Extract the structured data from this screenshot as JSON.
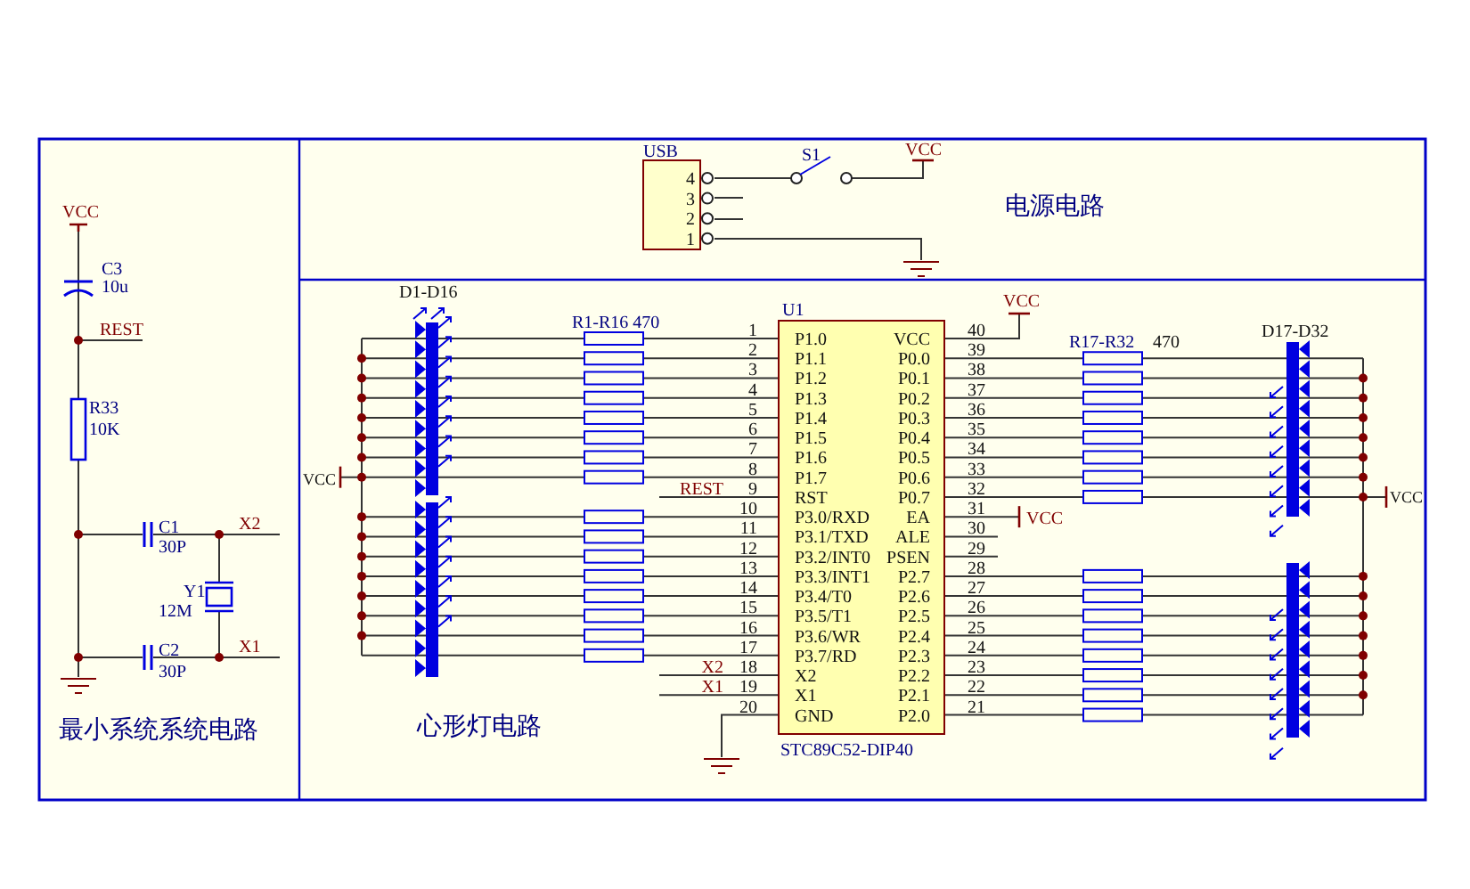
{
  "minimum_system": {
    "title": "最小系统系统电路",
    "vcc": "VCC",
    "c3": {
      "ref": "C3",
      "value": "10u"
    },
    "rest": "REST",
    "r33": {
      "ref": "R33",
      "value": "10K"
    },
    "c1": {
      "ref": "C1",
      "value": "30P"
    },
    "c2": {
      "ref": "C2",
      "value": "30P"
    },
    "y1": {
      "ref": "Y1",
      "value": "12M"
    },
    "x2": "X2",
    "x1": "X1"
  },
  "power": {
    "title": "电源电路",
    "usb": {
      "ref": "USB",
      "pins": [
        "4",
        "3",
        "2",
        "1"
      ]
    },
    "switch": "S1",
    "vcc": "VCC"
  },
  "heart_lights": {
    "title": "心形灯电路",
    "left_leds": "D1-D16",
    "left_resistors": "R1-R16 470",
    "left_vcc": "VCC",
    "right_resistors": "R17-R32",
    "right_resistor_value": "470",
    "right_leds": "D17-D32",
    "right_vcc": "VCC"
  },
  "chip": {
    "ref": "U1",
    "part": "STC89C52-DIP40",
    "vcc_pin40": "VCC",
    "vcc_pin31": "VCC",
    "left_pins": [
      {
        "number": "1",
        "name": "P1.0"
      },
      {
        "number": "2",
        "name": "P1.1"
      },
      {
        "number": "3",
        "name": "P1.2"
      },
      {
        "number": "4",
        "name": "P1.3"
      },
      {
        "number": "5",
        "name": "P1.4"
      },
      {
        "number": "6",
        "name": "P1.5"
      },
      {
        "number": "7",
        "name": "P1.6"
      },
      {
        "number": "8",
        "name": "P1.7"
      },
      {
        "number": "9",
        "name": "RST",
        "net": "REST"
      },
      {
        "number": "10",
        "name": "P3.0/RXD"
      },
      {
        "number": "11",
        "name": "P3.1/TXD"
      },
      {
        "number": "12",
        "name": "P3.2/INT0"
      },
      {
        "number": "13",
        "name": "P3.3/INT1"
      },
      {
        "number": "14",
        "name": "P3.4/T0"
      },
      {
        "number": "15",
        "name": "P3.5/T1"
      },
      {
        "number": "16",
        "name": "P3.6/WR"
      },
      {
        "number": "17",
        "name": "P3.7/RD"
      },
      {
        "number": "18",
        "name": "X2",
        "net": "X2"
      },
      {
        "number": "19",
        "name": "X1",
        "net": "X1"
      },
      {
        "number": "20",
        "name": "GND"
      }
    ],
    "right_pins": [
      {
        "number": "40",
        "name": "VCC"
      },
      {
        "number": "39",
        "name": "P0.0"
      },
      {
        "number": "38",
        "name": "P0.1"
      },
      {
        "number": "37",
        "name": "P0.2"
      },
      {
        "number": "36",
        "name": "P0.3"
      },
      {
        "number": "35",
        "name": "P0.4"
      },
      {
        "number": "34",
        "name": "P0.5"
      },
      {
        "number": "33",
        "name": "P0.6"
      },
      {
        "number": "32",
        "name": "P0.7"
      },
      {
        "number": "31",
        "name": "EA"
      },
      {
        "number": "30",
        "name": "ALE"
      },
      {
        "number": "29",
        "name": "PSEN"
      },
      {
        "number": "28",
        "name": "P2.7"
      },
      {
        "number": "27",
        "name": "P2.6"
      },
      {
        "number": "26",
        "name": "P2.5"
      },
      {
        "number": "25",
        "name": "P2.4"
      },
      {
        "number": "24",
        "name": "P2.3"
      },
      {
        "number": "23",
        "name": "P2.2"
      },
      {
        "number": "22",
        "name": "P2.1"
      },
      {
        "number": "21",
        "name": "P2.0"
      }
    ]
  }
}
